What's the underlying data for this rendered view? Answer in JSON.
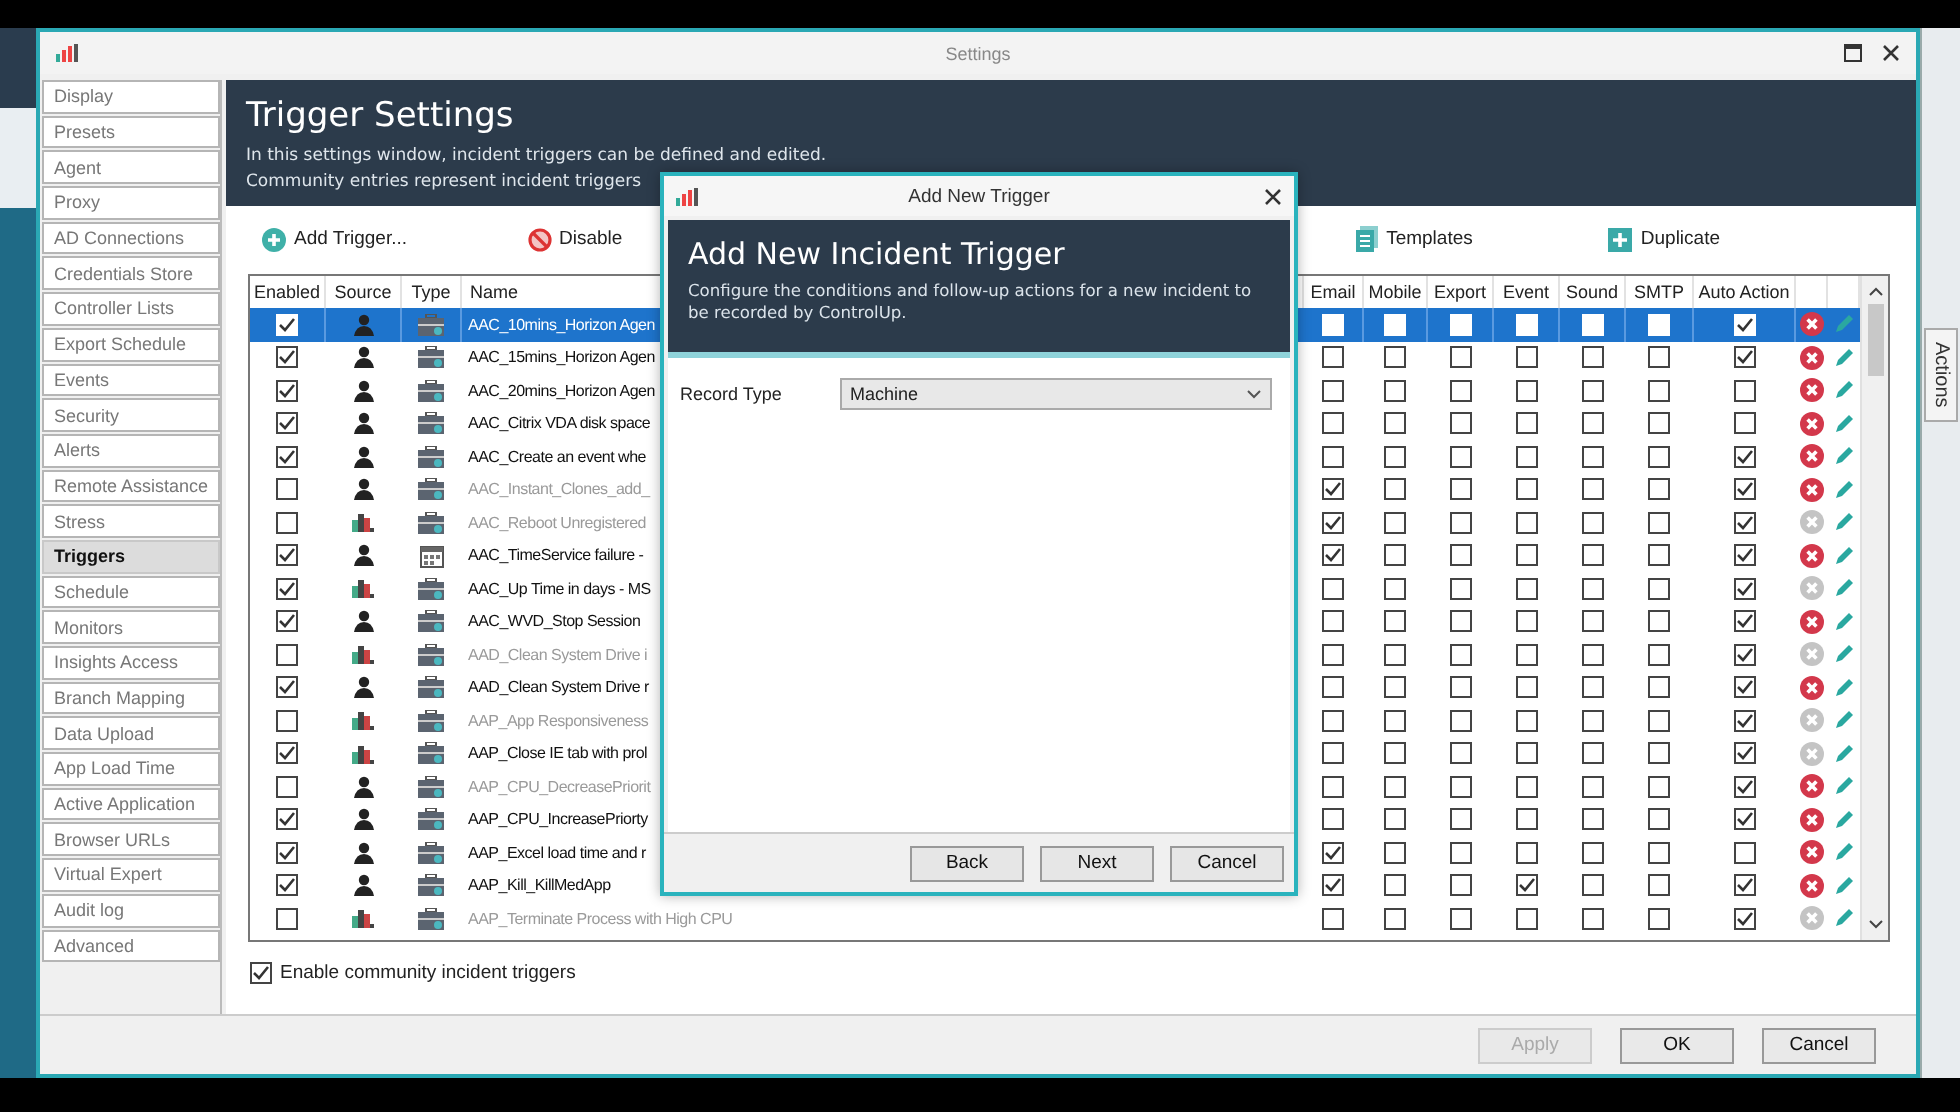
{
  "window": {
    "title": "Settings"
  },
  "sidebar": {
    "items": [
      {
        "label": "Display",
        "selected": false
      },
      {
        "label": "Presets",
        "selected": false
      },
      {
        "label": "Agent",
        "selected": false
      },
      {
        "label": "Proxy",
        "selected": false
      },
      {
        "label": "AD Connections",
        "selected": false
      },
      {
        "label": "Credentials Store",
        "selected": false
      },
      {
        "label": "Controller Lists",
        "selected": false
      },
      {
        "label": "Export Schedule",
        "selected": false
      },
      {
        "label": "Events",
        "selected": false
      },
      {
        "label": "Security",
        "selected": false
      },
      {
        "label": "Alerts",
        "selected": false
      },
      {
        "label": "Remote Assistance",
        "selected": false
      },
      {
        "label": "Stress",
        "selected": false
      },
      {
        "label": "Triggers",
        "selected": true
      },
      {
        "label": "Schedule",
        "selected": false
      },
      {
        "label": "Monitors",
        "selected": false
      },
      {
        "label": "Insights Access",
        "selected": false
      },
      {
        "label": "Branch Mapping",
        "selected": false
      },
      {
        "label": "Data Upload",
        "selected": false
      },
      {
        "label": "App Load Time",
        "selected": false
      },
      {
        "label": "Active Application",
        "selected": false
      },
      {
        "label": "Browser URLs",
        "selected": false
      },
      {
        "label": "Virtual Expert",
        "selected": false
      },
      {
        "label": "Audit log",
        "selected": false
      },
      {
        "label": "Advanced",
        "selected": false
      }
    ]
  },
  "header": {
    "title": "Trigger Settings",
    "lines": [
      "In this settings window, incident triggers can be defined and edited.",
      "Community entries represent incident triggers"
    ]
  },
  "toolbar": {
    "left": [
      {
        "label": "Add Trigger..."
      },
      {
        "label": "Disable"
      }
    ],
    "right": [
      {
        "label": "Templates"
      },
      {
        "label": "Duplicate"
      }
    ]
  },
  "table": {
    "columns": [
      "Enabled",
      "Source",
      "Type",
      "Name",
      "Email",
      "Mobile",
      "Export",
      "Event",
      "Sound",
      "SMTP",
      "Auto Action"
    ],
    "rows": [
      {
        "selected": true,
        "enabled": true,
        "community": false,
        "scheduled": false,
        "name": "AAC_10mins_Horizon Agen",
        "flags": [
          false,
          false,
          false,
          false,
          false,
          false,
          true
        ],
        "delete_active": true
      },
      {
        "selected": false,
        "enabled": true,
        "community": false,
        "scheduled": false,
        "name": "AAC_15mins_Horizon Agen",
        "flags": [
          false,
          false,
          false,
          false,
          false,
          false,
          true
        ],
        "delete_active": true
      },
      {
        "selected": false,
        "enabled": true,
        "community": false,
        "scheduled": false,
        "name": "AAC_20mins_Horizon Agen",
        "flags": [
          false,
          false,
          false,
          false,
          false,
          false,
          false
        ],
        "delete_active": true
      },
      {
        "selected": false,
        "enabled": true,
        "community": false,
        "scheduled": false,
        "name": "AAC_Citrix VDA disk space",
        "flags": [
          false,
          false,
          false,
          false,
          false,
          false,
          false
        ],
        "delete_active": true
      },
      {
        "selected": false,
        "enabled": true,
        "community": false,
        "scheduled": false,
        "name": "AAC_Create an event whe",
        "flags": [
          false,
          false,
          false,
          false,
          false,
          false,
          true
        ],
        "delete_active": true
      },
      {
        "selected": false,
        "enabled": false,
        "community": false,
        "scheduled": false,
        "name": "AAC_Instant_Clones_add_",
        "flags": [
          true,
          false,
          false,
          false,
          false,
          false,
          true
        ],
        "delete_active": true
      },
      {
        "selected": false,
        "enabled": false,
        "community": true,
        "scheduled": false,
        "name": "AAC_Reboot Unregistered",
        "flags": [
          true,
          false,
          false,
          false,
          false,
          false,
          true
        ],
        "delete_active": false
      },
      {
        "selected": false,
        "enabled": true,
        "community": false,
        "scheduled": true,
        "name": "AAC_TimeService failure -",
        "flags": [
          true,
          false,
          false,
          false,
          false,
          false,
          true
        ],
        "delete_active": true
      },
      {
        "selected": false,
        "enabled": true,
        "community": true,
        "scheduled": false,
        "name": "AAC_Up Time in days - MS",
        "flags": [
          false,
          false,
          false,
          false,
          false,
          false,
          true
        ],
        "delete_active": false
      },
      {
        "selected": false,
        "enabled": true,
        "community": false,
        "scheduled": false,
        "name": "AAC_WVD_Stop Session",
        "flags": [
          false,
          false,
          false,
          false,
          false,
          false,
          true
        ],
        "delete_active": true
      },
      {
        "selected": false,
        "enabled": false,
        "community": true,
        "scheduled": false,
        "name": "AAD_Clean System Drive i",
        "flags": [
          false,
          false,
          false,
          false,
          false,
          false,
          true
        ],
        "delete_active": false
      },
      {
        "selected": false,
        "enabled": true,
        "community": false,
        "scheduled": false,
        "name": "AAD_Clean System Drive r",
        "flags": [
          false,
          false,
          false,
          false,
          false,
          false,
          true
        ],
        "delete_active": true
      },
      {
        "selected": false,
        "enabled": false,
        "community": true,
        "scheduled": false,
        "name": "AAP_App Responsiveness",
        "flags": [
          false,
          false,
          false,
          false,
          false,
          false,
          true
        ],
        "delete_active": false
      },
      {
        "selected": false,
        "enabled": true,
        "community": true,
        "scheduled": false,
        "name": "AAP_Close IE tab with prol",
        "flags": [
          false,
          false,
          false,
          false,
          false,
          false,
          true
        ],
        "delete_active": false
      },
      {
        "selected": false,
        "enabled": false,
        "community": false,
        "scheduled": false,
        "name": "AAP_CPU_DecreasePriorit",
        "flags": [
          false,
          false,
          false,
          false,
          false,
          false,
          true
        ],
        "delete_active": true
      },
      {
        "selected": false,
        "enabled": true,
        "community": false,
        "scheduled": false,
        "name": "AAP_CPU_IncreasePriorty",
        "flags": [
          false,
          false,
          false,
          false,
          false,
          false,
          true
        ],
        "delete_active": true
      },
      {
        "selected": false,
        "enabled": true,
        "community": false,
        "scheduled": false,
        "name": "AAP_Excel load time and r",
        "flags": [
          true,
          false,
          false,
          false,
          false,
          false,
          false
        ],
        "delete_active": true
      },
      {
        "selected": false,
        "enabled": true,
        "community": false,
        "scheduled": false,
        "name": "AAP_Kill_KillMedApp",
        "flags": [
          true,
          false,
          false,
          true,
          false,
          false,
          true
        ],
        "delete_active": true
      },
      {
        "selected": false,
        "enabled": false,
        "community": true,
        "scheduled": false,
        "name": "AAP_Terminate Process with High CPU",
        "flags": [
          false,
          false,
          false,
          false,
          false,
          false,
          true
        ],
        "delete_active": false
      }
    ]
  },
  "community_option": {
    "label": "Enable community incident triggers",
    "checked": true
  },
  "buttons": [
    {
      "label": "Apply",
      "disabled": true
    },
    {
      "label": "OK",
      "disabled": false
    },
    {
      "label": "Cancel",
      "disabled": false
    }
  ],
  "side_panel": {
    "tab": "Actions"
  },
  "dialog": {
    "title": "Add New Trigger",
    "heading": "Add New Incident Trigger",
    "description": "Configure the conditions and follow-up actions for a new incident to be recorded by ControlUp.",
    "fields": [
      {
        "label": "Record Type",
        "value": "Machine"
      }
    ],
    "buttons": [
      {
        "label": "Back"
      },
      {
        "label": "Next"
      },
      {
        "label": "Cancel"
      }
    ]
  }
}
